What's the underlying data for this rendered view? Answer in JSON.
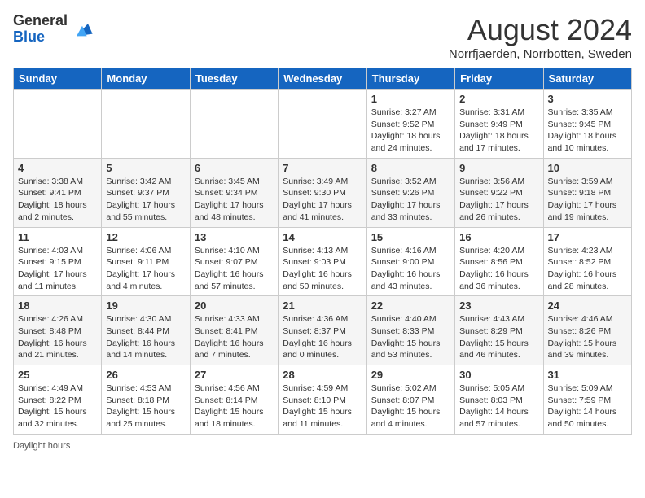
{
  "header": {
    "logo_general": "General",
    "logo_blue": "Blue",
    "month_title": "August 2024",
    "location": "Norrfjaerden, Norrbotten, Sweden"
  },
  "days_of_week": [
    "Sunday",
    "Monday",
    "Tuesday",
    "Wednesday",
    "Thursday",
    "Friday",
    "Saturday"
  ],
  "weeks": [
    [
      {
        "day": "",
        "info": ""
      },
      {
        "day": "",
        "info": ""
      },
      {
        "day": "",
        "info": ""
      },
      {
        "day": "",
        "info": ""
      },
      {
        "day": "1",
        "info": "Sunrise: 3:27 AM\nSunset: 9:52 PM\nDaylight: 18 hours and 24 minutes."
      },
      {
        "day": "2",
        "info": "Sunrise: 3:31 AM\nSunset: 9:49 PM\nDaylight: 18 hours and 17 minutes."
      },
      {
        "day": "3",
        "info": "Sunrise: 3:35 AM\nSunset: 9:45 PM\nDaylight: 18 hours and 10 minutes."
      }
    ],
    [
      {
        "day": "4",
        "info": "Sunrise: 3:38 AM\nSunset: 9:41 PM\nDaylight: 18 hours and 2 minutes."
      },
      {
        "day": "5",
        "info": "Sunrise: 3:42 AM\nSunset: 9:37 PM\nDaylight: 17 hours and 55 minutes."
      },
      {
        "day": "6",
        "info": "Sunrise: 3:45 AM\nSunset: 9:34 PM\nDaylight: 17 hours and 48 minutes."
      },
      {
        "day": "7",
        "info": "Sunrise: 3:49 AM\nSunset: 9:30 PM\nDaylight: 17 hours and 41 minutes."
      },
      {
        "day": "8",
        "info": "Sunrise: 3:52 AM\nSunset: 9:26 PM\nDaylight: 17 hours and 33 minutes."
      },
      {
        "day": "9",
        "info": "Sunrise: 3:56 AM\nSunset: 9:22 PM\nDaylight: 17 hours and 26 minutes."
      },
      {
        "day": "10",
        "info": "Sunrise: 3:59 AM\nSunset: 9:18 PM\nDaylight: 17 hours and 19 minutes."
      }
    ],
    [
      {
        "day": "11",
        "info": "Sunrise: 4:03 AM\nSunset: 9:15 PM\nDaylight: 17 hours and 11 minutes."
      },
      {
        "day": "12",
        "info": "Sunrise: 4:06 AM\nSunset: 9:11 PM\nDaylight: 17 hours and 4 minutes."
      },
      {
        "day": "13",
        "info": "Sunrise: 4:10 AM\nSunset: 9:07 PM\nDaylight: 16 hours and 57 minutes."
      },
      {
        "day": "14",
        "info": "Sunrise: 4:13 AM\nSunset: 9:03 PM\nDaylight: 16 hours and 50 minutes."
      },
      {
        "day": "15",
        "info": "Sunrise: 4:16 AM\nSunset: 9:00 PM\nDaylight: 16 hours and 43 minutes."
      },
      {
        "day": "16",
        "info": "Sunrise: 4:20 AM\nSunset: 8:56 PM\nDaylight: 16 hours and 36 minutes."
      },
      {
        "day": "17",
        "info": "Sunrise: 4:23 AM\nSunset: 8:52 PM\nDaylight: 16 hours and 28 minutes."
      }
    ],
    [
      {
        "day": "18",
        "info": "Sunrise: 4:26 AM\nSunset: 8:48 PM\nDaylight: 16 hours and 21 minutes."
      },
      {
        "day": "19",
        "info": "Sunrise: 4:30 AM\nSunset: 8:44 PM\nDaylight: 16 hours and 14 minutes."
      },
      {
        "day": "20",
        "info": "Sunrise: 4:33 AM\nSunset: 8:41 PM\nDaylight: 16 hours and 7 minutes."
      },
      {
        "day": "21",
        "info": "Sunrise: 4:36 AM\nSunset: 8:37 PM\nDaylight: 16 hours and 0 minutes."
      },
      {
        "day": "22",
        "info": "Sunrise: 4:40 AM\nSunset: 8:33 PM\nDaylight: 15 hours and 53 minutes."
      },
      {
        "day": "23",
        "info": "Sunrise: 4:43 AM\nSunset: 8:29 PM\nDaylight: 15 hours and 46 minutes."
      },
      {
        "day": "24",
        "info": "Sunrise: 4:46 AM\nSunset: 8:26 PM\nDaylight: 15 hours and 39 minutes."
      }
    ],
    [
      {
        "day": "25",
        "info": "Sunrise: 4:49 AM\nSunset: 8:22 PM\nDaylight: 15 hours and 32 minutes."
      },
      {
        "day": "26",
        "info": "Sunrise: 4:53 AM\nSunset: 8:18 PM\nDaylight: 15 hours and 25 minutes."
      },
      {
        "day": "27",
        "info": "Sunrise: 4:56 AM\nSunset: 8:14 PM\nDaylight: 15 hours and 18 minutes."
      },
      {
        "day": "28",
        "info": "Sunrise: 4:59 AM\nSunset: 8:10 PM\nDaylight: 15 hours and 11 minutes."
      },
      {
        "day": "29",
        "info": "Sunrise: 5:02 AM\nSunset: 8:07 PM\nDaylight: 15 hours and 4 minutes."
      },
      {
        "day": "30",
        "info": "Sunrise: 5:05 AM\nSunset: 8:03 PM\nDaylight: 14 hours and 57 minutes."
      },
      {
        "day": "31",
        "info": "Sunrise: 5:09 AM\nSunset: 7:59 PM\nDaylight: 14 hours and 50 minutes."
      }
    ]
  ],
  "footer": {
    "daylight_label": "Daylight hours"
  }
}
